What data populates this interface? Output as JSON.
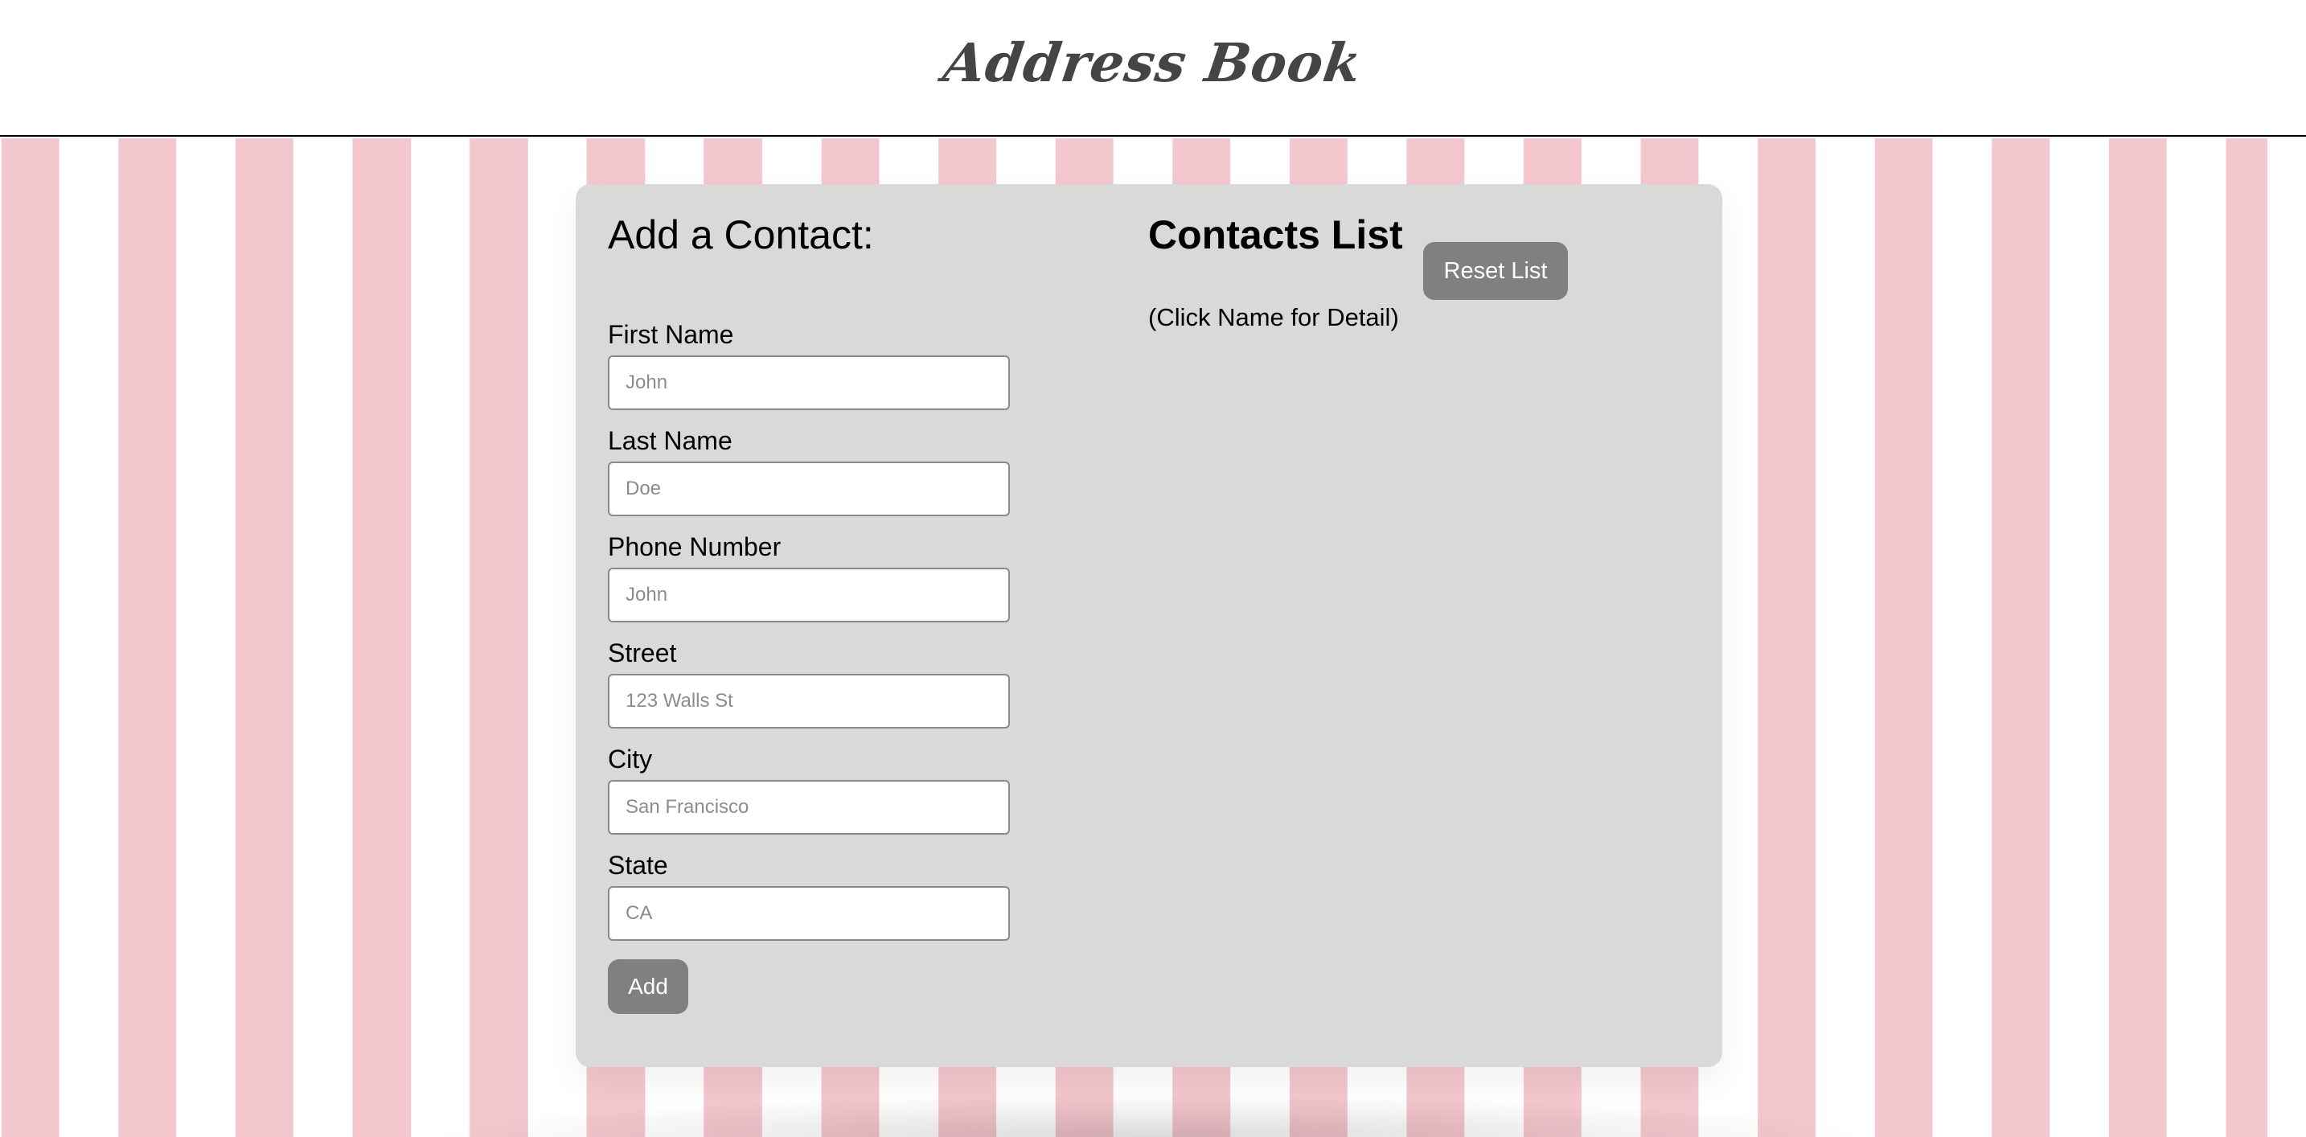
{
  "header": {
    "title": "Address Book"
  },
  "add_contact": {
    "title": "Add a Contact:",
    "fields": [
      {
        "label": "First Name",
        "placeholder": "John",
        "value": ""
      },
      {
        "label": "Last Name",
        "placeholder": "Doe",
        "value": ""
      },
      {
        "label": "Phone Number",
        "placeholder": "John",
        "value": ""
      },
      {
        "label": "Street",
        "placeholder": "123 Walls St",
        "value": ""
      },
      {
        "label": "City",
        "placeholder": "San Francisco",
        "value": ""
      },
      {
        "label": "State",
        "placeholder": "CA",
        "value": ""
      }
    ],
    "add_label": "Add"
  },
  "contacts": {
    "title": "Contacts List",
    "reset_label": "Reset List",
    "hint": "(Click Name for Detail)",
    "items": []
  },
  "colors": {
    "stripe_pink": "#f4c6ce",
    "panel_gray": "#d9d9d9",
    "button_gray": "#808080",
    "title_text": "#454545"
  }
}
